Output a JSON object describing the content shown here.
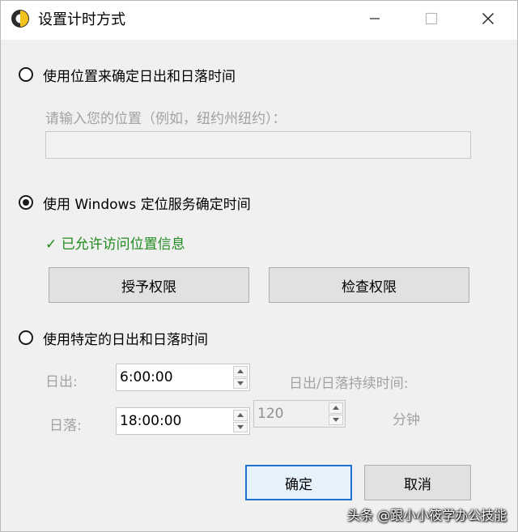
{
  "window": {
    "title": "设置计时方式",
    "controls": {
      "minimize": "—",
      "maximize": "☐",
      "close": "✕"
    }
  },
  "location_option": {
    "label": "使用位置来确定日出和日落时间",
    "selected": false,
    "prompt": "请输入您的位置（例如，纽约州纽约）：",
    "input_value": "",
    "input_placeholder": ""
  },
  "windows_option": {
    "label": "使用 Windows 定位服务确定时间",
    "selected": true,
    "status": "✓ 已允许访问位置信息",
    "grant_button": "授予权限",
    "check_button": "检查权限"
  },
  "custom_option": {
    "label": "使用特定的日出和日落时间",
    "selected": false,
    "sunrise_label": "日出:",
    "sunrise_value": "6:00:00",
    "sunset_label": "日落:",
    "sunset_value": "18:00:00",
    "duration_label": "日出/日落持续时间:",
    "duration_value": "120",
    "duration_unit": "分钟"
  },
  "footer": {
    "ok_button": "确定",
    "cancel_button": "取消"
  },
  "watermark": "头条 @跟小小筱学办公技能",
  "colors": {
    "status_green": "#1f8a1f",
    "primary_border": "#1e73d2",
    "dialog_background": "#f0f0f0"
  }
}
